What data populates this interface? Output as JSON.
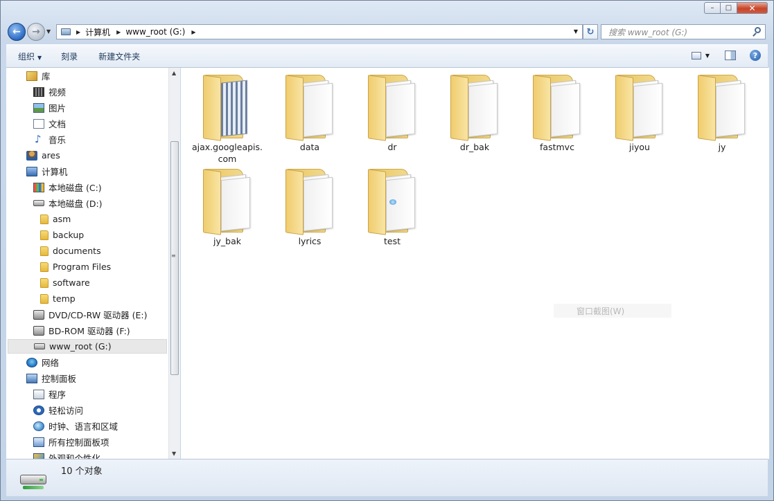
{
  "window": {
    "caption_buttons": {
      "minimize": "–",
      "maximize": "□",
      "close": "✕"
    }
  },
  "address_bar": {
    "breadcrumb": [
      "计算机",
      "www_root (G:)"
    ]
  },
  "search": {
    "placeholder": "搜索 www_root (G:)"
  },
  "toolbar": {
    "organize_label": "组织",
    "burn_label": "刻录",
    "new_folder_label": "新建文件夹",
    "help_label": "?"
  },
  "navigation_pane": {
    "items": [
      {
        "label": "库",
        "icon": "library-icon"
      },
      {
        "label": "视频",
        "icon": "video-icon"
      },
      {
        "label": "图片",
        "icon": "pictures-icon"
      },
      {
        "label": "文档",
        "icon": "documents-icon"
      },
      {
        "label": "音乐",
        "icon": "music-icon"
      },
      {
        "label": "ares",
        "icon": "user-icon"
      },
      {
        "label": "计算机",
        "icon": "computer-icon"
      },
      {
        "label": "本地磁盘 (C:)",
        "icon": "system-disk-icon"
      },
      {
        "label": "本地磁盘 (D:)",
        "icon": "disk-icon"
      },
      {
        "label": "asm",
        "icon": "folder-icon"
      },
      {
        "label": "backup",
        "icon": "folder-icon"
      },
      {
        "label": "documents",
        "icon": "folder-icon"
      },
      {
        "label": "Program Files",
        "icon": "folder-icon"
      },
      {
        "label": "software",
        "icon": "folder-icon"
      },
      {
        "label": "temp",
        "icon": "folder-icon"
      },
      {
        "label": "DVD/CD-RW 驱动器 (E:)",
        "icon": "dvd-drive-icon"
      },
      {
        "label": "BD-ROM 驱动器 (F:)",
        "icon": "bd-drive-icon"
      },
      {
        "label": "www_root (G:)",
        "icon": "network-drive-icon",
        "selected": true
      },
      {
        "label": "网络",
        "icon": "network-icon"
      },
      {
        "label": "控制面板",
        "icon": "control-panel-icon"
      },
      {
        "label": "程序",
        "icon": "programs-icon"
      },
      {
        "label": "轻松访问",
        "icon": "ease-of-access-icon"
      },
      {
        "label": "时钟、语言和区域",
        "icon": "clock-language-icon"
      },
      {
        "label": "所有控制面板项",
        "icon": "all-control-panel-icon"
      },
      {
        "label": "外观和个性化",
        "icon": "appearance-icon"
      }
    ]
  },
  "folders": [
    {
      "name": "ajax.googleapis.com"
    },
    {
      "name": "data"
    },
    {
      "name": "dr"
    },
    {
      "name": "dr_bak"
    },
    {
      "name": "fastmvc"
    },
    {
      "name": "jiyou"
    },
    {
      "name": "jy"
    },
    {
      "name": "jy_bak"
    },
    {
      "name": "lyrics"
    },
    {
      "name": "test"
    }
  ],
  "ghost_menu_item": "窗口截图(W)",
  "status_bar": {
    "item_count": "10 个对象"
  }
}
